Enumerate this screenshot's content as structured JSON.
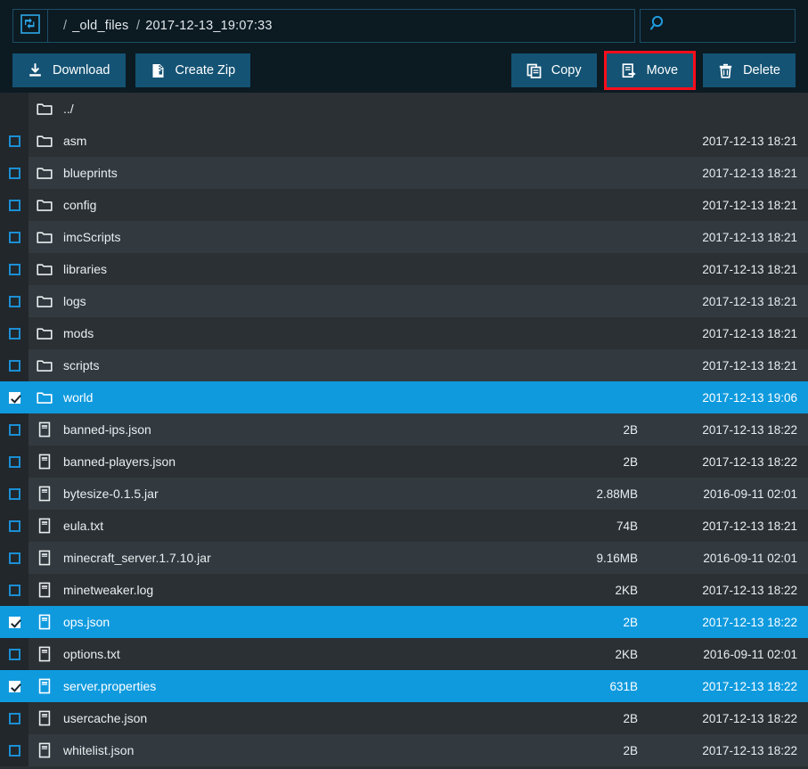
{
  "header": {
    "logo_icon": "transfer-arrows-icon",
    "breadcrumb": {
      "sep1": "/",
      "segment1": "_old_files",
      "sep2": "/",
      "segment2": "2017-12-13_19:07:33",
      "full": "/ _old_files / 2017-12-13_19:07:33"
    },
    "search": {
      "icon": "search-icon",
      "value": "",
      "placeholder": ""
    }
  },
  "toolbar": {
    "left": [
      {
        "id": "download",
        "label": "Download",
        "icon": "download-icon"
      },
      {
        "id": "create-zip",
        "label": "Create Zip",
        "icon": "file-archive-icon"
      }
    ],
    "right": [
      {
        "id": "copy",
        "label": "Copy",
        "icon": "copy-files-icon",
        "highlighted": false
      },
      {
        "id": "move",
        "label": "Move",
        "icon": "file-move-arrow-icon",
        "highlighted": true
      },
      {
        "id": "delete",
        "label": "Delete",
        "icon": "trash-icon",
        "highlighted": false
      }
    ],
    "highlight_color": "#fc0d1b",
    "button_color": "#145374"
  },
  "colors": {
    "header_bg": "#0c1a22",
    "row_even": "#2b3034",
    "row_odd": "#323a3f",
    "selected": "#0f9ade",
    "checkbox_border": "#1b8fd4"
  },
  "filelist": {
    "parent": {
      "name": "../",
      "icon": "folder-icon",
      "type": "parent",
      "size": "",
      "date": ""
    },
    "rows": [
      {
        "name": "asm",
        "icon": "folder-icon",
        "type": "folder",
        "size": "",
        "date": "2017-12-13 18:21",
        "selected": false
      },
      {
        "name": "blueprints",
        "icon": "folder-icon",
        "type": "folder",
        "size": "",
        "date": "2017-12-13 18:21",
        "selected": false
      },
      {
        "name": "config",
        "icon": "folder-icon",
        "type": "folder",
        "size": "",
        "date": "2017-12-13 18:21",
        "selected": false
      },
      {
        "name": "imcScripts",
        "icon": "folder-icon",
        "type": "folder",
        "size": "",
        "date": "2017-12-13 18:21",
        "selected": false
      },
      {
        "name": "libraries",
        "icon": "folder-icon",
        "type": "folder",
        "size": "",
        "date": "2017-12-13 18:21",
        "selected": false
      },
      {
        "name": "logs",
        "icon": "folder-icon",
        "type": "folder",
        "size": "",
        "date": "2017-12-13 18:21",
        "selected": false
      },
      {
        "name": "mods",
        "icon": "folder-icon",
        "type": "folder",
        "size": "",
        "date": "2017-12-13 18:21",
        "selected": false
      },
      {
        "name": "scripts",
        "icon": "folder-icon",
        "type": "folder",
        "size": "",
        "date": "2017-12-13 18:21",
        "selected": false
      },
      {
        "name": "world",
        "icon": "folder-icon",
        "type": "folder",
        "size": "",
        "date": "2017-12-13 19:06",
        "selected": true
      },
      {
        "name": "banned-ips.json",
        "icon": "file-icon",
        "type": "file",
        "size": "2B",
        "date": "2017-12-13 18:22",
        "selected": false
      },
      {
        "name": "banned-players.json",
        "icon": "file-icon",
        "type": "file",
        "size": "2B",
        "date": "2017-12-13 18:22",
        "selected": false
      },
      {
        "name": "bytesize-0.1.5.jar",
        "icon": "file-icon",
        "type": "file",
        "size": "2.88MB",
        "date": "2016-09-11 02:01",
        "selected": false
      },
      {
        "name": "eula.txt",
        "icon": "file-icon",
        "type": "file",
        "size": "74B",
        "date": "2017-12-13 18:21",
        "selected": false
      },
      {
        "name": "minecraft_server.1.7.10.jar",
        "icon": "file-icon",
        "type": "file",
        "size": "9.16MB",
        "date": "2016-09-11 02:01",
        "selected": false
      },
      {
        "name": "minetweaker.log",
        "icon": "file-icon",
        "type": "file",
        "size": "2KB",
        "date": "2017-12-13 18:22",
        "selected": false
      },
      {
        "name": "ops.json",
        "icon": "file-icon",
        "type": "file",
        "size": "2B",
        "date": "2017-12-13 18:22",
        "selected": true
      },
      {
        "name": "options.txt",
        "icon": "file-icon",
        "type": "file",
        "size": "2KB",
        "date": "2016-09-11 02:01",
        "selected": false
      },
      {
        "name": "server.properties",
        "icon": "file-icon",
        "type": "file",
        "size": "631B",
        "date": "2017-12-13 18:22",
        "selected": true
      },
      {
        "name": "usercache.json",
        "icon": "file-icon",
        "type": "file",
        "size": "2B",
        "date": "2017-12-13 18:22",
        "selected": false
      },
      {
        "name": "whitelist.json",
        "icon": "file-icon",
        "type": "file",
        "size": "2B",
        "date": "2017-12-13 18:22",
        "selected": false
      }
    ]
  }
}
